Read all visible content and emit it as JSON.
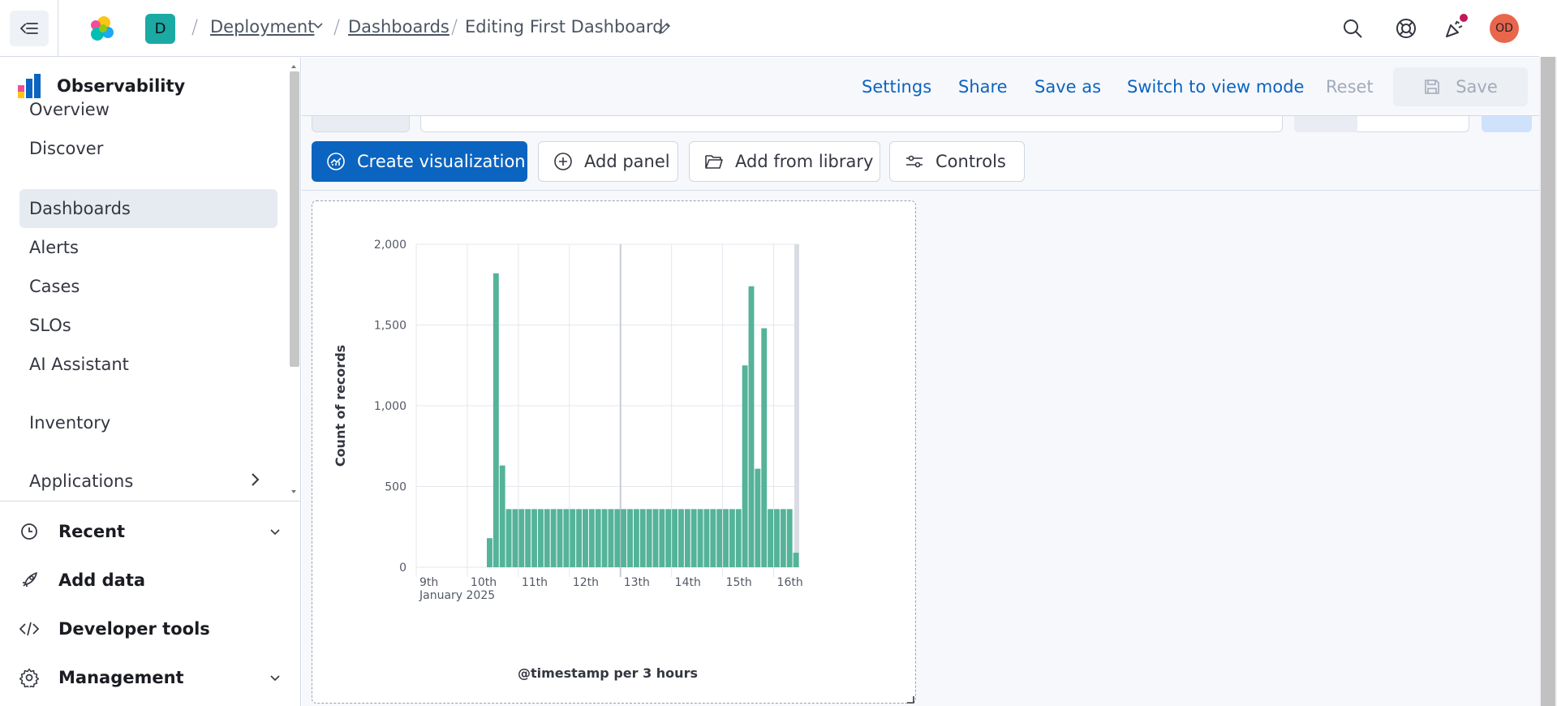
{
  "header": {
    "space_initial": "D",
    "breadcrumbs": [
      "Deployment",
      "Dashboards",
      "Editing First Dashboard"
    ],
    "avatar_initials": "OD"
  },
  "sidebar": {
    "title": "Observability",
    "items": [
      {
        "label": "Overview",
        "active": false
      },
      {
        "label": "Discover",
        "active": false
      },
      {
        "label": "Dashboards",
        "active": true
      },
      {
        "label": "Alerts",
        "active": false
      },
      {
        "label": "Cases",
        "active": false
      },
      {
        "label": "SLOs",
        "active": false
      },
      {
        "label": "AI Assistant",
        "active": false
      },
      {
        "label": "Inventory",
        "active": false
      },
      {
        "label": "Applications",
        "active": false
      }
    ],
    "sections": [
      {
        "label": "Recent",
        "icon": "clock-icon"
      },
      {
        "label": "Add data",
        "icon": "rocket-icon"
      },
      {
        "label": "Developer tools",
        "icon": "code-icon"
      },
      {
        "label": "Management",
        "icon": "gear-icon"
      }
    ]
  },
  "actions": {
    "settings": "Settings",
    "share": "Share",
    "save_as": "Save as",
    "switch_view": "Switch to view mode",
    "reset": "Reset",
    "save": "Save"
  },
  "toolbar": {
    "create_viz": "Create visualization",
    "add_panel": "Add panel",
    "add_from_library": "Add from library",
    "controls": "Controls"
  },
  "colors": {
    "accent": "#0b64c0",
    "bar": "#54b399",
    "space_badge": "#1ba9a4",
    "avatar": "#e7664c"
  },
  "chart_data": {
    "type": "bar",
    "title": "",
    "xlabel": "@timestamp per 3 hours",
    "ylabel": "Count of records",
    "ylim": [
      0,
      2000
    ],
    "yticks": [
      0,
      500,
      1000,
      1500,
      2000
    ],
    "ytick_labels": [
      "0",
      "500",
      "1,000",
      "1,500",
      "2,000"
    ],
    "x_tick_labels": [
      "9th",
      "10th",
      "11th",
      "12th",
      "13th",
      "14th",
      "15th",
      "16th"
    ],
    "x_sublabel": "January 2025",
    "x_start": "2025-01-09T00:00",
    "bin_hours": 3,
    "values": [
      0,
      0,
      0,
      0,
      0,
      0,
      0,
      0,
      0,
      0,
      0,
      180,
      1820,
      630,
      360,
      360,
      360,
      360,
      360,
      360,
      360,
      360,
      360,
      360,
      360,
      360,
      360,
      360,
      360,
      360,
      360,
      360,
      360,
      360,
      360,
      360,
      360,
      360,
      360,
      360,
      360,
      360,
      360,
      360,
      360,
      360,
      360,
      360,
      360,
      360,
      360,
      1250,
      1740,
      610,
      1480,
      360,
      360,
      360,
      360,
      90
    ]
  }
}
